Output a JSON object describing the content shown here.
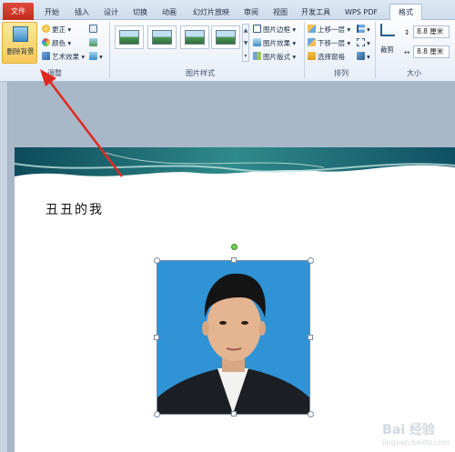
{
  "tabs": [
    {
      "label": "文件"
    },
    {
      "label": "开始"
    },
    {
      "label": "插入"
    },
    {
      "label": "设计"
    },
    {
      "label": "切换"
    },
    {
      "label": "动画"
    },
    {
      "label": "幻灯片放映"
    },
    {
      "label": "审阅"
    },
    {
      "label": "视图"
    },
    {
      "label": "开发工具"
    },
    {
      "label": "WPS PDF"
    },
    {
      "label": "格式"
    }
  ],
  "adjust": {
    "remove_bg": "删除背景",
    "corrections": "更正",
    "color": "颜色",
    "artistic": "艺术效果",
    "label": "调整"
  },
  "picture_styles": {
    "border": "图片边框",
    "effects": "图片效果",
    "layout": "图片版式",
    "label": "图片样式"
  },
  "arrange": {
    "bring_forward": "上移一层",
    "send_backward": "下移一层",
    "selection_pane": "选择窗格",
    "label": "排列"
  },
  "size": {
    "crop": "裁剪",
    "height": "8.8 厘米",
    "width": "8.8 厘米",
    "label": "大小"
  },
  "slide": {
    "title": "丑丑的我"
  },
  "watermark": {
    "brand": "Bai 经验",
    "url": "jingyan.baidu.com"
  },
  "colors": {
    "accent_red": "#e02a20",
    "file_tab": "#d23a2a",
    "photo_bg": "#2f93d6"
  }
}
